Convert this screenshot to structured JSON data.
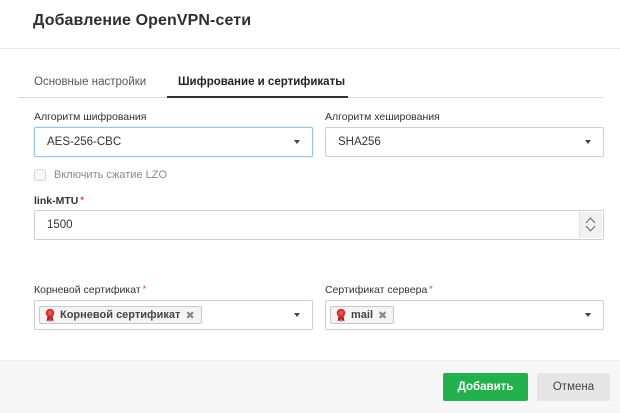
{
  "dialog": {
    "title": "Добавление OpenVPN-сети"
  },
  "tabs": [
    {
      "label": "Основные настройки",
      "active": false
    },
    {
      "label": "Шифрование и сертификаты",
      "active": true
    }
  ],
  "encryption": {
    "label": "Алгоритм шифрования",
    "value": "AES-256-CBC"
  },
  "hashing": {
    "label": "Алгоритм хеширования",
    "value": "SHA256"
  },
  "compression": {
    "label": "Включить сжатие LZO",
    "checked": false
  },
  "mtu": {
    "label": "link-MTU",
    "required_mark": "*",
    "value": "1500"
  },
  "root_cert": {
    "label": "Корневой сертификат",
    "required_mark": "*",
    "tags": [
      "Корневой сертификат"
    ],
    "remove_glyph": "✖"
  },
  "server_cert": {
    "label": "Сертификат сервера",
    "required_mark": "*",
    "tags": [
      "mail"
    ],
    "remove_glyph": "✖"
  },
  "footer": {
    "add_label": "Добавить",
    "cancel_label": "Отмена"
  },
  "colors": {
    "primary_button": "#22b14c",
    "required_asterisk": "#e53935",
    "cert_icon": "#d32f2f",
    "focus_border": "#9ac5e8"
  },
  "icons": {
    "cert": "certificate-ribbon-icon",
    "dropdown": "caret-down-icon",
    "remove": "remove-tag-icon",
    "spin_up": "chevron-up-icon",
    "spin_down": "chevron-down-icon"
  }
}
